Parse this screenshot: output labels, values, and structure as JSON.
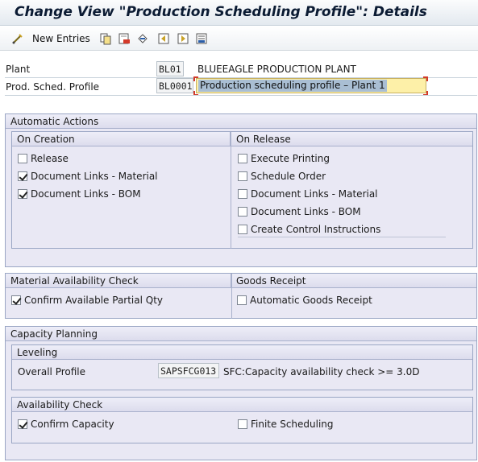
{
  "window": {
    "title": "Change View \"Production Scheduling Profile\": Details"
  },
  "toolbar": {
    "new_entries_label": "New Entries"
  },
  "header": {
    "plant_label": "Plant",
    "plant_value": "BL01",
    "plant_description": "BLUEEAGLE  PRODUCTION PLANT",
    "profile_label": "Prod. Sched. Profile",
    "profile_value": "BL0001",
    "profile_description": "Production scheduling profile – Plant 1"
  },
  "automatic_actions": {
    "title": "Automatic Actions",
    "on_creation": {
      "title": "On Creation",
      "items": [
        {
          "label": "Release",
          "checked": false
        },
        {
          "label": "Document Links - Material",
          "checked": true
        },
        {
          "label": "Document Links - BOM",
          "checked": true
        }
      ]
    },
    "on_release": {
      "title": "On Release",
      "items": [
        {
          "label": "Execute Printing",
          "checked": false
        },
        {
          "label": "Schedule Order",
          "checked": false
        },
        {
          "label": "Document Links - Material",
          "checked": false
        },
        {
          "label": "Document Links - BOM",
          "checked": false
        },
        {
          "label": "Create Control Instructions",
          "checked": false
        }
      ]
    }
  },
  "material_availability": {
    "title": "Material Availability Check",
    "confirm_partial_label": "Confirm Available Partial Qty",
    "confirm_partial_checked": true
  },
  "goods_receipt": {
    "title": "Goods Receipt",
    "automatic_label": "Automatic Goods Receipt",
    "automatic_checked": false
  },
  "capacity_planning": {
    "title": "Capacity Planning",
    "leveling": {
      "title": "Leveling",
      "overall_profile_label": "Overall Profile",
      "overall_profile_value": "SAPSFCG013",
      "overall_profile_description": "SFC:Capacity availability check >= 3.0D"
    },
    "availability_check": {
      "title": "Availability Check",
      "confirm_capacity_label": "Confirm Capacity",
      "confirm_capacity_checked": true,
      "finite_scheduling_label": "Finite Scheduling",
      "finite_scheduling_checked": false
    }
  },
  "colors": {
    "group_bg": "#e9e8f4",
    "input_highlight": "#fdf0a8",
    "selection": "#a9bed3"
  }
}
